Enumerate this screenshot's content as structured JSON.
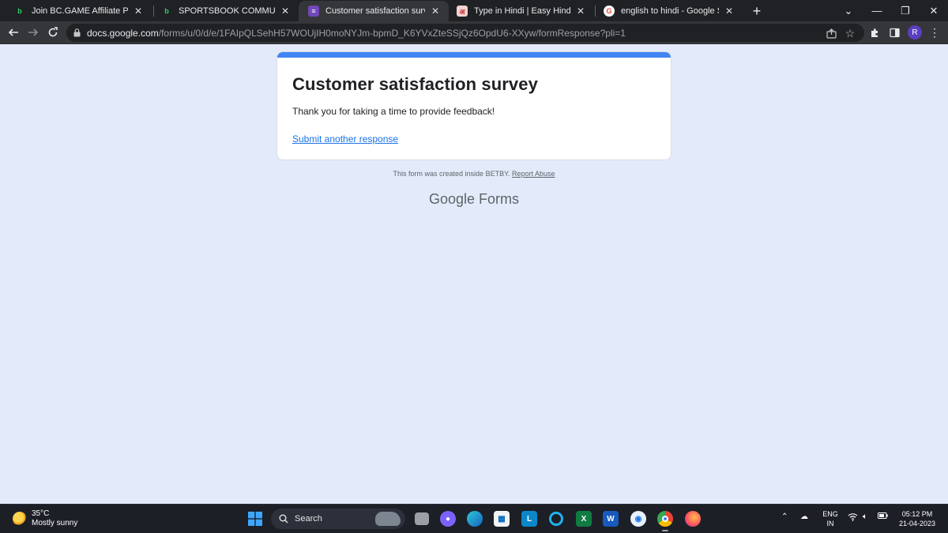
{
  "browser": {
    "tabs": [
      {
        "title": "Join BC.GAME Affiliate Program",
        "favicon": "b",
        "favicon_color": "#2bd16a",
        "favicon_bg": "transparent",
        "active": false
      },
      {
        "title": "SPORTSBOOK COMMUNITY SURVEY",
        "favicon": "b",
        "favicon_color": "#2bd16a",
        "favicon_bg": "transparent",
        "active": false
      },
      {
        "title": "Customer satisfaction survey",
        "favicon": "≡",
        "favicon_color": "#ffffff",
        "favicon_bg": "#7248b9",
        "active": true
      },
      {
        "title": "Type in Hindi | Easy Hindi Typing",
        "favicon": "अ",
        "favicon_color": "#c62828",
        "favicon_bg": "#f3d2d2",
        "active": false
      },
      {
        "title": "english to hindi - Google Search",
        "favicon": "G",
        "favicon_color": "#ea4335",
        "favicon_bg": "#ffffff",
        "active": false
      }
    ],
    "url_host": "docs.google.com",
    "url_path": "/forms/u/0/d/e/1FAIpQLSehH57WOUjIH0moNYJm-bpmD_K6YVxZteSSjQz6OpdU6-XXyw/formResponse?pli=1",
    "profile_initial": "R"
  },
  "form": {
    "title": "Customer satisfaction survey",
    "confirmation": "Thank you for taking a time to provide feedback!",
    "submit_another": "Submit another response",
    "footer_text": "This form was created inside BETBY.",
    "report_abuse": "Report Abuse",
    "brand_google": "Google",
    "brand_forms": "Forms",
    "accent_color": "#4285f4"
  },
  "taskbar": {
    "temperature": "35°C",
    "weather": "Mostly sunny",
    "search_label": "Search",
    "lang_line1": "ENG",
    "lang_line2": "IN",
    "time": "05:12 PM",
    "date": "21-04-2023"
  }
}
